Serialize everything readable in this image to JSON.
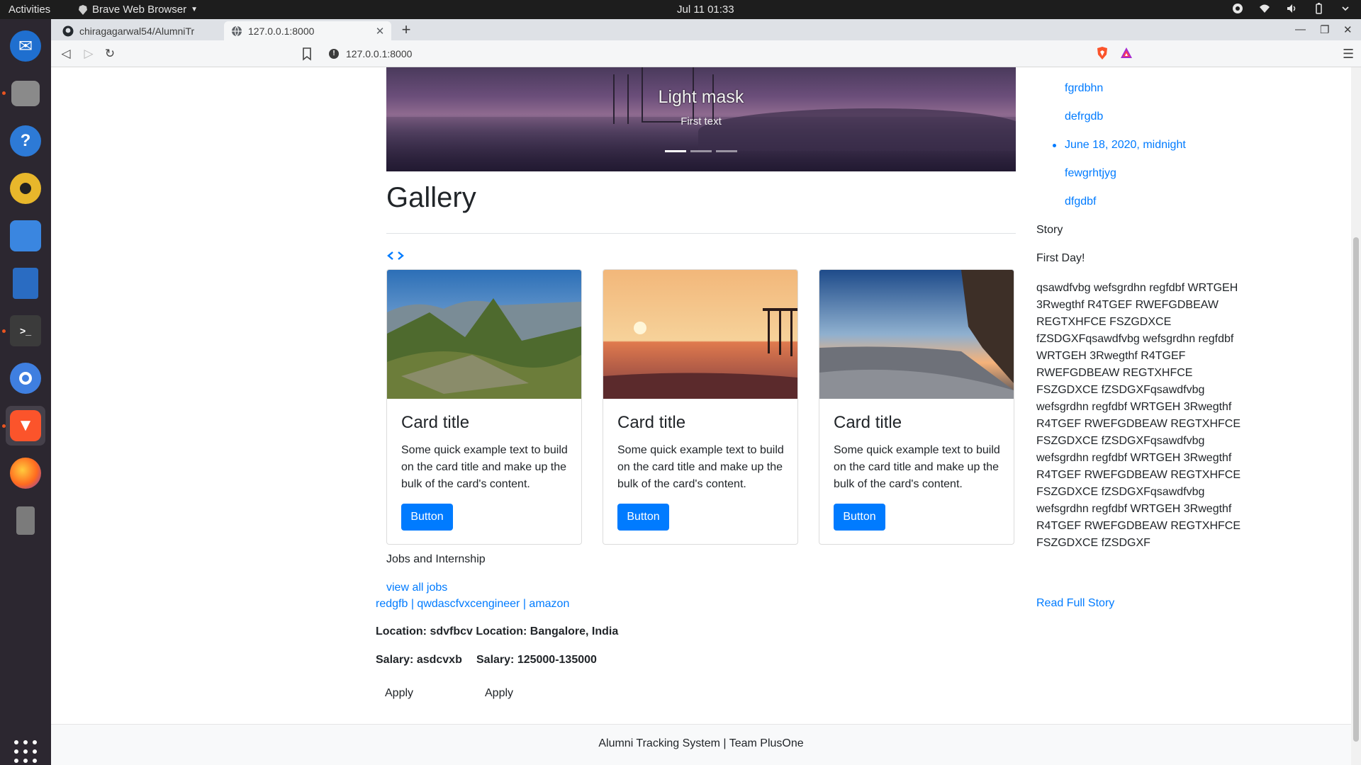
{
  "system": {
    "activities": "Activities",
    "app_name": "Brave Web Browser",
    "clock": "Jul 11  01:33"
  },
  "browser": {
    "tabs": [
      {
        "title": "chiragagarwal54/AlumniTr",
        "favicon": "github-icon"
      },
      {
        "title": "127.0.0.1:8000",
        "favicon": "globe-icon"
      }
    ],
    "url": "127.0.0.1:8000"
  },
  "carousel": {
    "caption_title": "Light mask",
    "caption_text": "First text",
    "slides": 3,
    "active_slide": 1
  },
  "gallery": {
    "heading": "Gallery",
    "cards": [
      {
        "title": "Card title",
        "text": "Some quick example text to build on the card title and make up the bulk of the card's content.",
        "button": "Button",
        "image": "mountain-ruins-photo"
      },
      {
        "title": "Card title",
        "text": "Some quick example text to build on the card title and make up the bulk of the card's content.",
        "button": "Button",
        "image": "sunset-pier-photo"
      },
      {
        "title": "Card title",
        "text": "Some quick example text to build on the card title and make up the bulk of the card's content.",
        "button": "Button",
        "image": "rocky-beach-photo"
      }
    ]
  },
  "jobs": {
    "heading": "Jobs and Internship",
    "view_all": "view all jobs",
    "links": "redgfb | qwdascfvxcengineer | amazon",
    "location_line": "Location: sdvfbcv Location: Bangalore, India",
    "salary_1": "Salary: asdcvxb",
    "salary_2": "Salary: 125000-135000",
    "apply_1": "Apply",
    "apply_2": "Apply"
  },
  "sidebar": {
    "events": [
      {
        "text": "fgrdbhn",
        "bullet": false
      },
      {
        "text": "defrgdb",
        "bullet": false
      },
      {
        "text": "June 18, 2020, midnight",
        "bullet": true
      },
      {
        "text": "fewgrhtjyg",
        "bullet": false
      },
      {
        "text": "dfgdbf",
        "bullet": false
      }
    ],
    "story_heading": "Story",
    "story_title": "First Day!",
    "story_body": "qsawdfvbg wefsgrdhn regfdbf WRTGEH 3Rwegthf R4TGEF RWEFGDBEAW REGTXHFCE FSZGDXCE fZSDGXFqsawdfvbg wefsgrdhn regfdbf WRTGEH 3Rwegthf R4TGEF RWEFGDBEAW REGTXHFCE FSZGDXCE fZSDGXFqsawdfvbg wefsgrdhn regfdbf WRTGEH 3Rwegthf R4TGEF RWEFGDBEAW REGTXHFCE FSZGDXCE fZSDGXFqsawdfvbg wefsgrdhn regfdbf WRTGEH 3Rwegthf R4TGEF RWEFGDBEAW REGTXHFCE FSZGDXCE fZSDGXFqsawdfvbg wefsgrdhn regfdbf WRTGEH 3Rwegthf R4TGEF RWEFGDBEAW REGTXHFCE FSZGDXCE fZSDGXF",
    "read_more": "Read Full Story"
  },
  "footer": {
    "text": "Alumni Tracking System | Team PlusOne"
  },
  "colors": {
    "link": "#007bff",
    "button": "#007bff",
    "dock_bg": "#2c2730",
    "topbar_bg": "#1d1d1d"
  }
}
